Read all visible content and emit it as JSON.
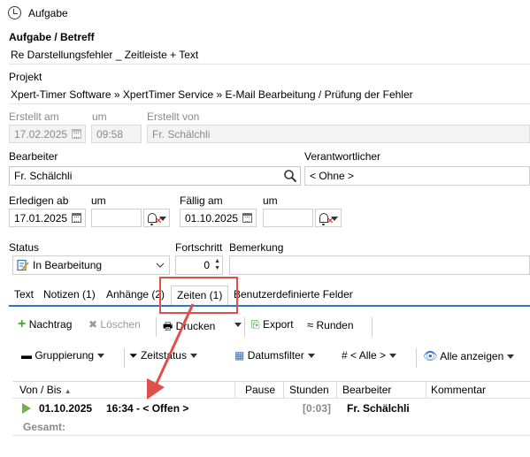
{
  "window": {
    "title": "Aufgabe"
  },
  "task": {
    "label": "Aufgabe / Betreff",
    "value": "Re Darstellungsfehler _ Zeitleiste + Text"
  },
  "project": {
    "label": "Projekt",
    "value": "Xpert-Timer Software » XpertTimer Service » E-Mail Bearbeitung / Prüfung der Fehler"
  },
  "created": {
    "label_date": "Erstellt am",
    "label_time": "um",
    "label_by": "Erstellt von",
    "date": "17.02.2025",
    "time": "09:58",
    "by": "Fr. Schälchli"
  },
  "editor": {
    "label": "Bearbeiter",
    "value": "Fr. Schälchli",
    "responsible_label": "Verantwortlicher",
    "responsible_value": "< Ohne >"
  },
  "schedule": {
    "do_label": "Erledigen ab",
    "do_time_label": "um",
    "do_date": "17.01.2025",
    "due_label": "Fällig am",
    "due_time_label": "um",
    "due_date": "01.10.2025"
  },
  "status": {
    "label": "Status",
    "value": "In Bearbeitung",
    "progress_label": "Fortschritt",
    "progress_value": "0",
    "remark_label": "Bemerkung"
  },
  "tabs": [
    {
      "label": "Text"
    },
    {
      "label": "Notizen (1)"
    },
    {
      "label": "Anhänge (2)"
    },
    {
      "label": "Zeiten (1)"
    },
    {
      "label": "Benutzerdefinierte Felder"
    }
  ],
  "toolbar1": {
    "add": "Nachtrag",
    "delete": "Löschen",
    "print": "Drucken",
    "export": "Export",
    "round": "Runden"
  },
  "toolbar2": {
    "group": "Gruppierung",
    "time_status": "Zeitstatus",
    "date_filter": "Datumsfilter",
    "all": "< Alle >",
    "show_all": "Alle anzeigen"
  },
  "grid": {
    "columns": [
      "Von / Bis",
      "Pause",
      "Stunden",
      "Bearbeiter",
      "Kommentar"
    ],
    "rows": [
      {
        "date": "01.10.2025",
        "time": "16:34 - < Offen >",
        "hours": "[0:03]",
        "editor": "Fr. Schälchli"
      }
    ],
    "total_label": "Gesamt:"
  },
  "colors": {
    "accent": "#2e74c7",
    "highlight": "#e0504a",
    "play": "#6bb34a"
  }
}
